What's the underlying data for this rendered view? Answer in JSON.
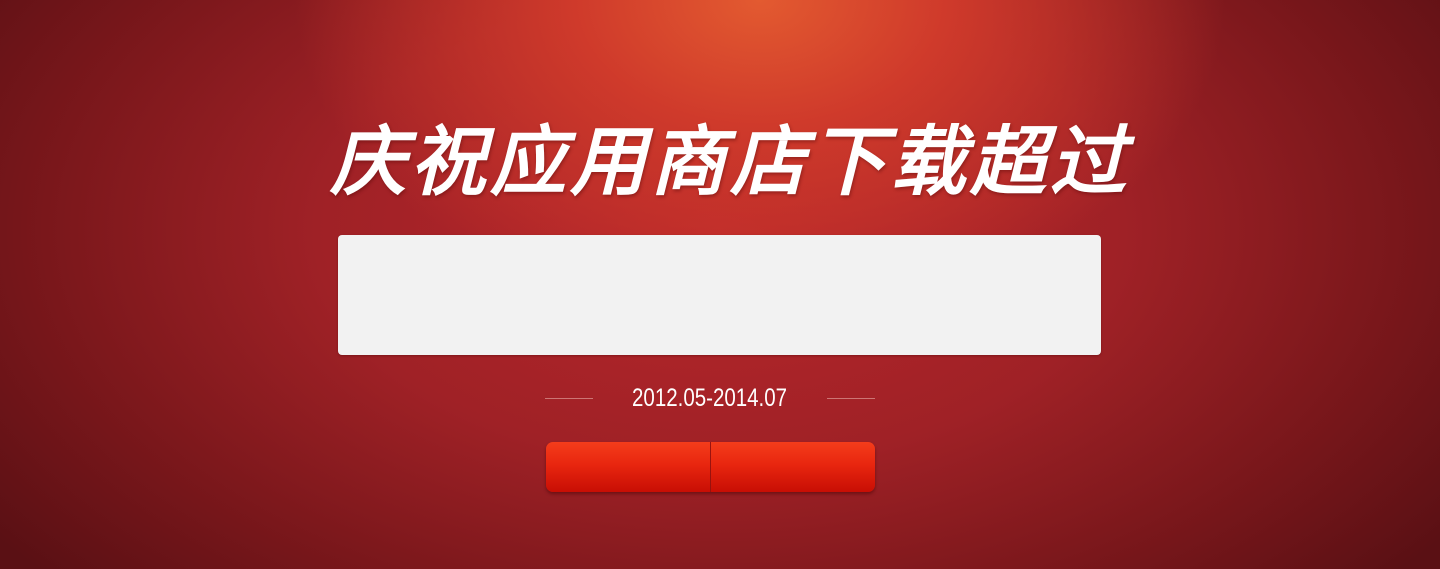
{
  "banner": {
    "headline": "庆祝应用商店下载超过",
    "date_range": "2012.05-2014.07"
  }
}
